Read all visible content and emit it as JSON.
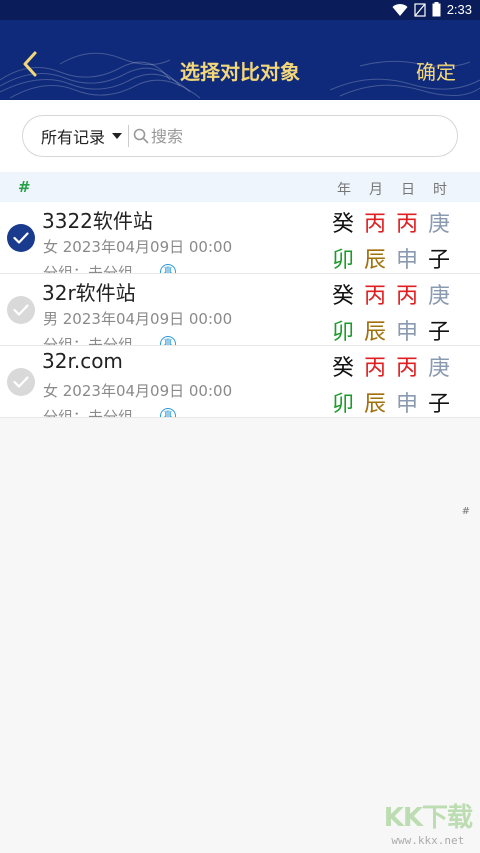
{
  "status_bar": {
    "time": "2:33",
    "icons": [
      "wifi-icon",
      "no-signal-icon",
      "battery-icon"
    ]
  },
  "header": {
    "title": "选择对比对象",
    "confirm_label": "确定",
    "back_icon": "chevron-left-icon"
  },
  "search": {
    "filter_label": "所有记录",
    "placeholder": "搜索",
    "value": ""
  },
  "columns": {
    "index_label": "#",
    "labels": [
      "年",
      "月",
      "日",
      "时"
    ]
  },
  "records": [
    {
      "name": "3322软件站",
      "meta": "女 2023年04月09日 00:00",
      "group": "分组：未分组",
      "tag": "真",
      "selected": true,
      "stems": [
        {
          "char": "癸",
          "color": "#111111"
        },
        {
          "char": "丙",
          "color": "#e02020"
        },
        {
          "char": "丙",
          "color": "#e02020"
        },
        {
          "char": "庚",
          "color": "#8a9bb0"
        }
      ],
      "branches": [
        {
          "char": "卯",
          "color": "#1c9a2c"
        },
        {
          "char": "辰",
          "color": "#a0700a"
        },
        {
          "char": "申",
          "color": "#8a9bb0"
        },
        {
          "char": "子",
          "color": "#111111"
        }
      ]
    },
    {
      "name": "32r软件站",
      "meta": "男 2023年04月09日 00:00",
      "group": "分组：未分组",
      "tag": "真",
      "selected": false,
      "stems": [
        {
          "char": "癸",
          "color": "#111111"
        },
        {
          "char": "丙",
          "color": "#e02020"
        },
        {
          "char": "丙",
          "color": "#e02020"
        },
        {
          "char": "庚",
          "color": "#8a9bb0"
        }
      ],
      "branches": [
        {
          "char": "卯",
          "color": "#1c9a2c"
        },
        {
          "char": "辰",
          "color": "#a0700a"
        },
        {
          "char": "申",
          "color": "#8a9bb0"
        },
        {
          "char": "子",
          "color": "#111111"
        }
      ]
    },
    {
      "name": "32r.com",
      "meta": "女 2023年04月09日 00:00",
      "group": "分组：未分组",
      "tag": "真",
      "selected": false,
      "stems": [
        {
          "char": "癸",
          "color": "#111111"
        },
        {
          "char": "丙",
          "color": "#e02020"
        },
        {
          "char": "丙",
          "color": "#e02020"
        },
        {
          "char": "庚",
          "color": "#8a9bb0"
        }
      ],
      "branches": [
        {
          "char": "卯",
          "color": "#1c9a2c"
        },
        {
          "char": "辰",
          "color": "#a0700a"
        },
        {
          "char": "申",
          "color": "#8a9bb0"
        },
        {
          "char": "子",
          "color": "#111111"
        }
      ]
    }
  ],
  "side_index": "#",
  "watermark": {
    "logo": "KK下载",
    "url": "www.kkx.net"
  },
  "colors": {
    "header_bg": "#0f2a7a",
    "title_gold": "#f3d77a",
    "check_on": "#1a3a8e",
    "check_off": "#d9d9d9"
  }
}
